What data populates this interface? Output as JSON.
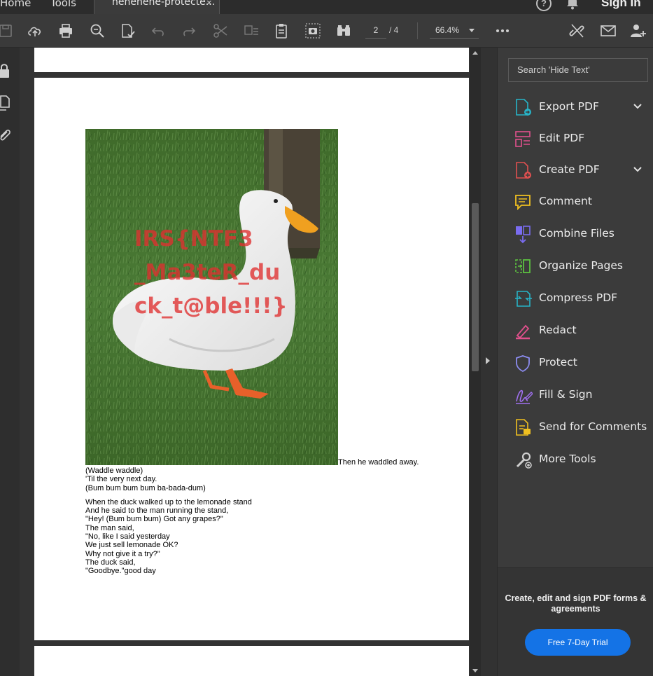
{
  "tabs": {
    "home": "Home",
    "tools": "Tools",
    "document": "hehehehe-protecte...",
    "close": "×"
  },
  "header": {
    "help": "?",
    "sign_in": "Sign In"
  },
  "toolbar": {
    "page_current": "2",
    "page_total": "/ 4",
    "zoom": "66.4%",
    "icons": [
      "save-icon",
      "cloud-upload-icon",
      "print-icon",
      "zoom-search-icon",
      "spellcheck-icon",
      "undo-icon",
      "redo-icon",
      "cut-icon",
      "text-edit-icon",
      "clipboard-icon",
      "snapshot-icon",
      "read-mode-icon",
      "more-icon",
      "link-share-icon",
      "mail-icon",
      "add-user-icon"
    ]
  },
  "document": {
    "image_overlay": [
      "IRS{NTF3",
      "_Ma3teR_du",
      "ck_t@ble!!!}"
    ],
    "beside_image": "Then he waddled away.",
    "stanzas": [
      [
        "(Waddle waddle)",
        "'Til the very next day.",
        "(Bum bum bum bum ba-bada-dum)"
      ],
      [
        "When the duck walked up to the lemonade stand",
        "And he said to the man running the stand,",
        "\"Hey! (Bum bum bum) Got any grapes?\"",
        "The man said,",
        "\"No, like I said yesterday",
        "We just sell lemonade OK?",
        "Why not give it a try?\"",
        "The duck said,",
        "\"Goodbye.\"good day"
      ]
    ]
  },
  "right_panel": {
    "search_placeholder": "Search 'Hide Text'",
    "tools": [
      {
        "label": "Export PDF",
        "icon": "export-pdf-icon",
        "color": "#27b4c8",
        "expandable": true
      },
      {
        "label": "Edit PDF",
        "icon": "edit-pdf-icon",
        "color": "#e0508c",
        "expandable": false
      },
      {
        "label": "Create PDF",
        "icon": "create-pdf-icon",
        "color": "#e05050",
        "expandable": true
      },
      {
        "label": "Comment",
        "icon": "comment-icon",
        "color": "#f0c020",
        "expandable": false
      },
      {
        "label": "Combine Files",
        "icon": "combine-files-icon",
        "color": "#7a6cf0",
        "expandable": false
      },
      {
        "label": "Organize Pages",
        "icon": "organize-pages-icon",
        "color": "#5cc040",
        "expandable": false
      },
      {
        "label": "Compress PDF",
        "icon": "compress-pdf-icon",
        "color": "#27b4c8",
        "expandable": false
      },
      {
        "label": "Redact",
        "icon": "redact-icon",
        "color": "#e0508c",
        "expandable": false
      },
      {
        "label": "Protect",
        "icon": "protect-icon",
        "color": "#8c8cf0",
        "expandable": false
      },
      {
        "label": "Fill & Sign",
        "icon": "fill-sign-icon",
        "color": "#a070f0",
        "expandable": false
      },
      {
        "label": "Send for Comments",
        "icon": "send-comments-icon",
        "color": "#f0c020",
        "expandable": false
      },
      {
        "label": "More Tools",
        "icon": "more-tools-icon",
        "color": "#cfcfcf",
        "expandable": false
      }
    ],
    "promo_text": "Create, edit and sign PDF forms & agreements",
    "trial_button": "Free 7-Day Trial"
  }
}
